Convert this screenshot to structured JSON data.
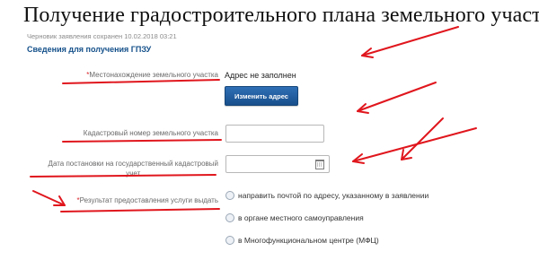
{
  "page": {
    "title": "Получение градостроительного плана земельного участка",
    "draft_note": "Черновик заявления сохранен 10.02.2018 03:21",
    "section_title": "Сведения для получения ГПЗУ"
  },
  "form": {
    "location": {
      "required_mark": "*",
      "label": "Местонахождение земельного участка",
      "value": "Адрес не заполнен",
      "button": "Изменить адрес"
    },
    "cadastral_number": {
      "label": "Кадастровый номер земельного участка",
      "value": ""
    },
    "registration_date": {
      "label_line1": "Дата постановки на государственный кадастровый",
      "label_line2": "учет",
      "value": "",
      "icon": "calendar-icon"
    },
    "delivery": {
      "required_mark": "*",
      "label": "Результат предоставления услуги выдать",
      "options": [
        "направить почтой по адресу, указанному в заявлении",
        "в органе местного самоуправления",
        "в Многофункциональном центре (МФЦ)"
      ]
    }
  },
  "annotation_color": "#e0161d"
}
